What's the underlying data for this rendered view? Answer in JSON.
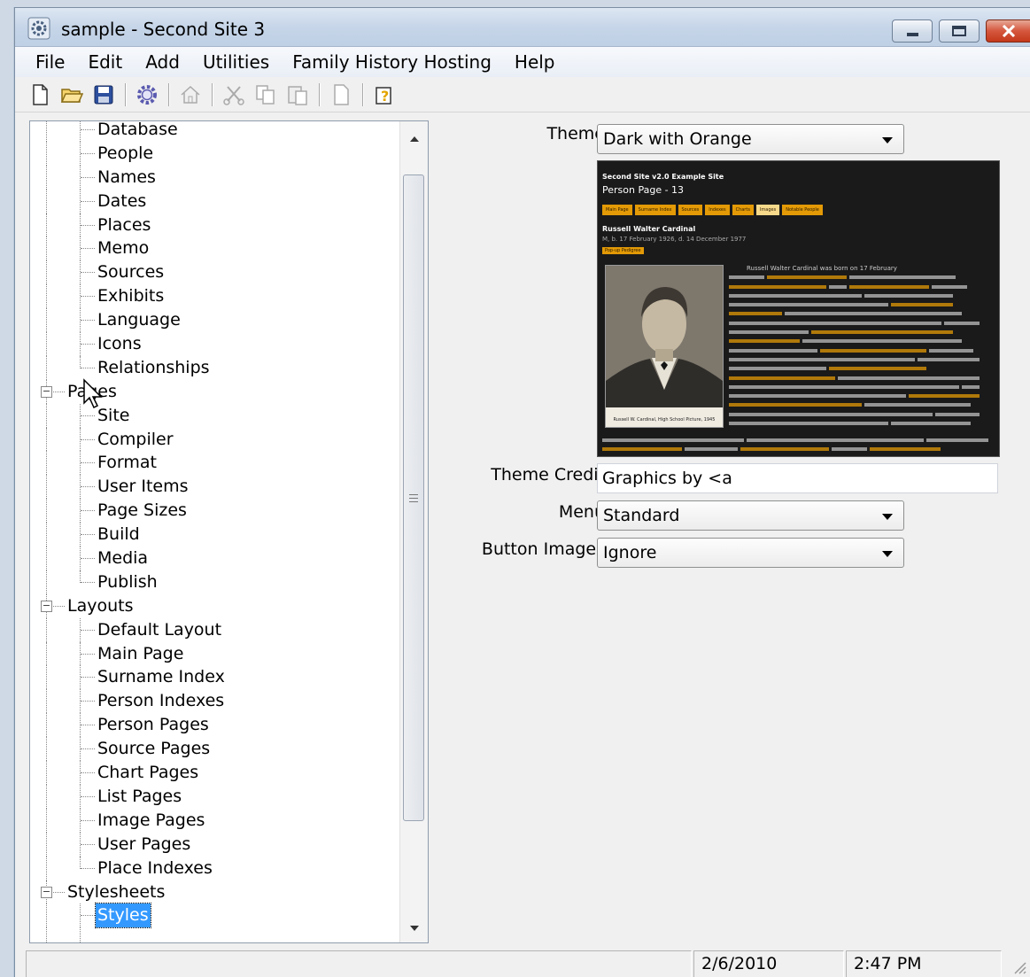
{
  "window": {
    "title": "sample - Second Site 3"
  },
  "menu": [
    "File",
    "Edit",
    "Add",
    "Utilities",
    "Family History Hosting",
    "Help"
  ],
  "toolbar": {
    "buttons": [
      "new-icon",
      "open-folder-icon",
      "save-icon",
      "settings-gear-icon",
      "home-icon",
      "cut-icon",
      "copy-icon",
      "paste-icon",
      "blank-page-icon",
      "help-icon"
    ]
  },
  "tree": {
    "first_children": [
      "Database",
      "People",
      "Names",
      "Dates",
      "Places",
      "Memo",
      "Sources",
      "Exhibits",
      "Language",
      "Icons",
      "Relationships"
    ],
    "pages_group": "Pages",
    "pages_children": [
      "Site",
      "Compiler",
      "Format",
      "User Items",
      "Page Sizes",
      "Build",
      "Media",
      "Publish"
    ],
    "layouts_group": "Layouts",
    "layouts_children": [
      "Default Layout",
      "Main Page",
      "Surname Index",
      "Person Indexes",
      "Person Pages",
      "Source Pages",
      "Chart Pages",
      "List Pages",
      "Image Pages",
      "User Pages",
      "Place Indexes"
    ],
    "stylesheets_group": "Stylesheets",
    "selected": "Styles"
  },
  "form": {
    "theme_label": "Theme",
    "theme_value": "Dark with Orange",
    "credit_label": "Theme Credit",
    "credit_value": "Graphics by <a",
    "menu_label": "Menu",
    "menu_value": "Standard",
    "button_images_label": "Button Images",
    "button_images_value": "Ignore"
  },
  "preview": {
    "site_title": "Second Site v2.0 Example Site",
    "page_title": "Person Page - 13",
    "nav": [
      "Main Page",
      "Surname Index",
      "Sources",
      "Indexes",
      "Charts",
      "Images",
      "Notable People"
    ],
    "person_name": "Russell Walter Cardinal",
    "person_dates": "M, b. 17 February 1926, d. 14 December 1977",
    "popup_button": "Pop-up Pedigree",
    "photo_caption": "Russell W. Cardinal, High School Picture, 1945",
    "bio_start": "Russell Walter Cardinal was born on 17 February"
  },
  "status": {
    "message": "",
    "date": "2/6/2010",
    "time": "2:47 PM"
  },
  "colors": {
    "accent_orange": "#e39a06",
    "selection_blue": "#3399ff"
  }
}
